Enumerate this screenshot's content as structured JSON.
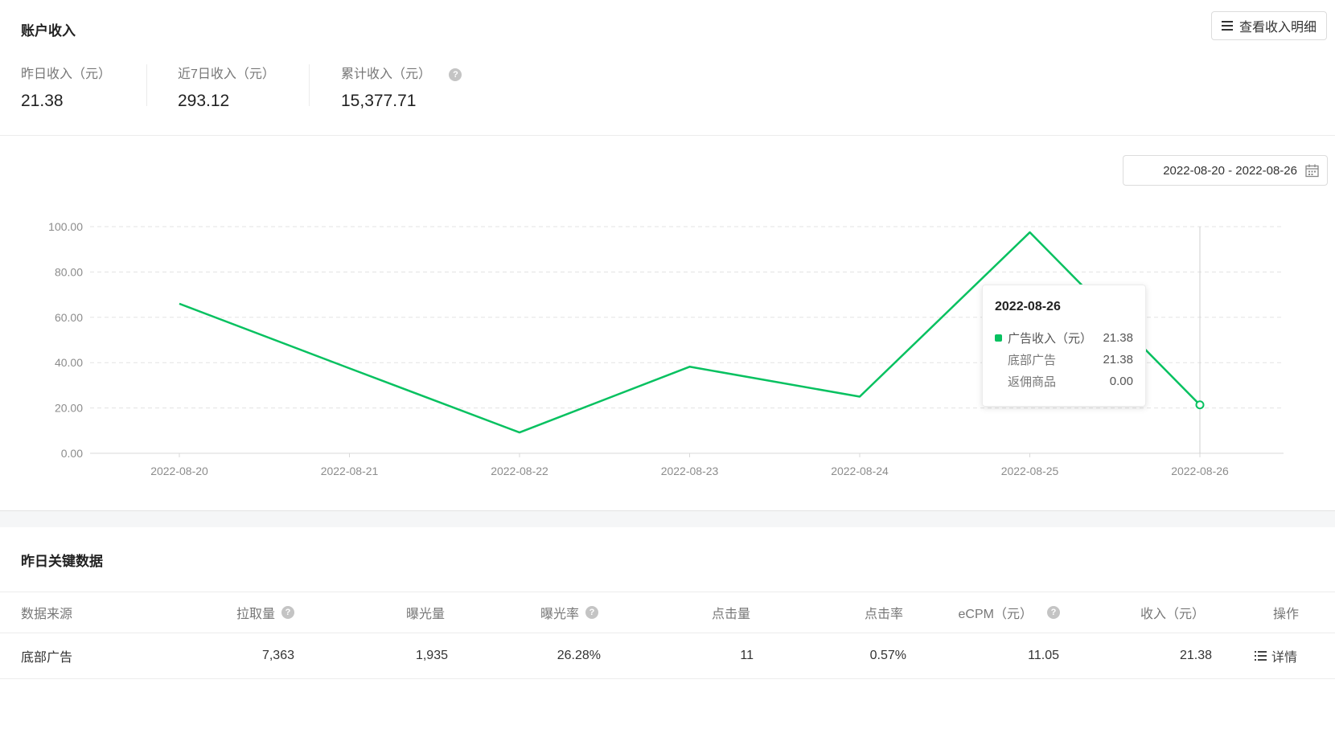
{
  "summary": {
    "title": "账户收入",
    "detail_button": "查看收入明细",
    "stats": [
      {
        "label": "昨日收入（元）",
        "value": "21.38"
      },
      {
        "label": "近7日收入（元）",
        "value": "293.12"
      },
      {
        "label": "累计收入（元）",
        "value": "15,377.71"
      }
    ]
  },
  "date_range": "2022-08-20 - 2022-08-26",
  "colors": {
    "accent": "#07c160",
    "grid": "#e3e3e3",
    "axis_text": "#8c8c8c"
  },
  "chart_data": {
    "type": "line",
    "x": [
      "2022-08-20",
      "2022-08-21",
      "2022-08-22",
      "2022-08-23",
      "2022-08-24",
      "2022-08-25",
      "2022-08-26"
    ],
    "y_ticks": [
      "0.00",
      "20.00",
      "40.00",
      "60.00",
      "80.00",
      "100.00"
    ],
    "ylim": [
      0,
      100
    ],
    "grid": true,
    "series": [
      {
        "name": "广告收入（元）",
        "values": [
          66.0,
          37.5,
          9.2,
          38.2,
          25.0,
          97.5,
          21.38
        ]
      }
    ]
  },
  "tooltip": {
    "date": "2022-08-26",
    "rows": [
      {
        "label": "广告收入（元）",
        "value": "21.38"
      },
      {
        "label": "底部广告",
        "value": "21.38"
      },
      {
        "label": "返佣商品",
        "value": "0.00"
      }
    ]
  },
  "key_data": {
    "title": "昨日关键数据",
    "columns": [
      "数据来源",
      "拉取量",
      "曝光量",
      "曝光率",
      "点击量",
      "点击率",
      "eCPM（元）",
      "收入（元）",
      "操作"
    ],
    "rows": [
      {
        "source": "底部广告",
        "pulls": "7,363",
        "impressions": "1,935",
        "impression_rate": "26.28%",
        "clicks": "11",
        "ctr": "0.57%",
        "ecpm": "11.05",
        "income": "21.38",
        "action": "详情"
      }
    ]
  }
}
